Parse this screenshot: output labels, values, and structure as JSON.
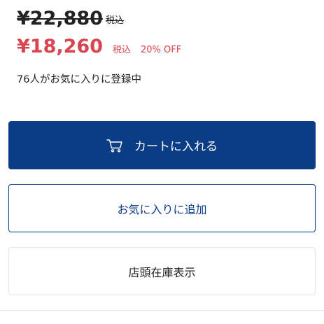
{
  "price": {
    "original": "¥22,880",
    "original_tax_label": "税込",
    "sale": "¥18,260",
    "sale_tax_label": "税込",
    "discount": "20% OFF"
  },
  "favorites": {
    "count_text": "76人がお気に入りに登録中"
  },
  "buttons": {
    "add_to_cart": "カートに入れる",
    "add_to_favorites": "お気に入りに追加",
    "store_stock": "店頭在庫表示"
  },
  "icons": {
    "cart": "cart-icon"
  },
  "colors": {
    "primary": "#0b3c86",
    "sale": "#d9454e",
    "text": "#222222"
  }
}
